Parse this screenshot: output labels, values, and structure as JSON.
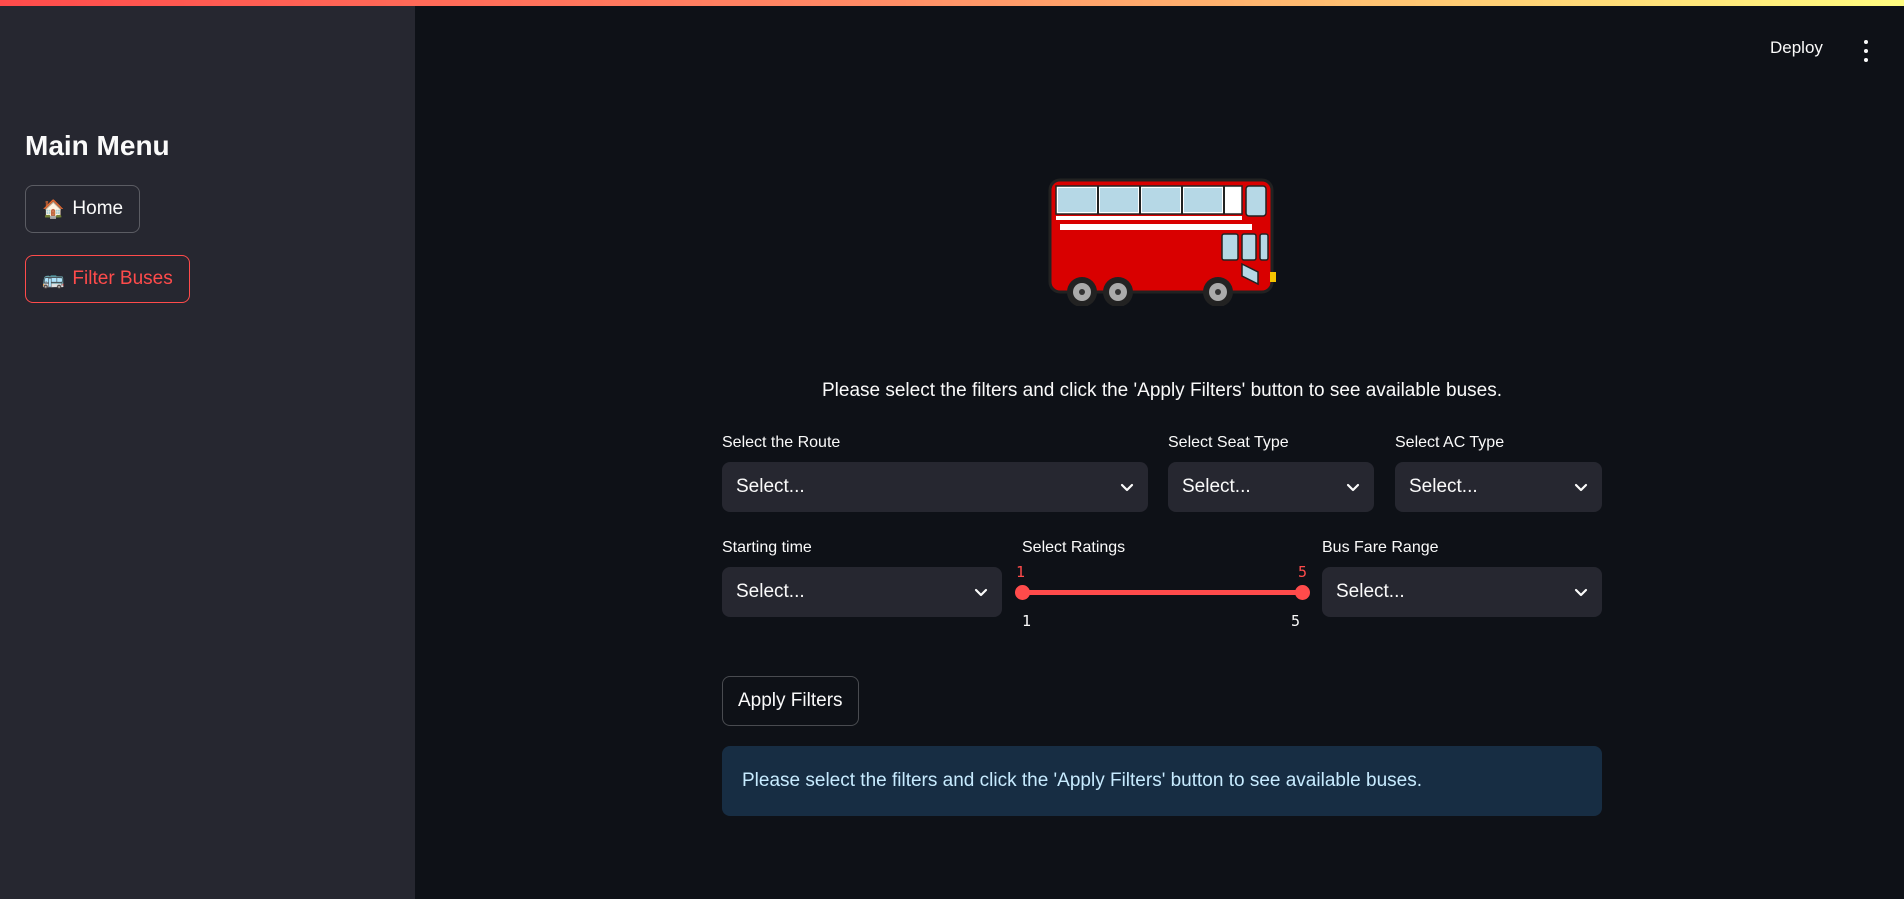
{
  "sidebar": {
    "title": "Main Menu",
    "items": [
      {
        "emoji": "🏠",
        "label": "Home"
      },
      {
        "emoji": "🚌",
        "label": "Filter Buses"
      }
    ]
  },
  "header": {
    "deploy_label": "Deploy"
  },
  "main": {
    "instruction": "Please select the filters and click the 'Apply Filters' button to see available buses.",
    "filters": {
      "route": {
        "label": "Select the Route",
        "value": "Select..."
      },
      "seat_type": {
        "label": "Select Seat Type",
        "value": "Select..."
      },
      "ac_type": {
        "label": "Select AC Type",
        "value": "Select..."
      },
      "starting_time": {
        "label": "Starting time",
        "value": "Select..."
      },
      "ratings": {
        "label": "Select Ratings",
        "low": "1",
        "high": "5",
        "min": "1",
        "max": "5"
      },
      "fare_range": {
        "label": "Bus Fare Range",
        "value": "Select..."
      }
    },
    "apply_button": "Apply Filters",
    "alert": "Please select the filters and click the 'Apply Filters' button to see available buses."
  },
  "colors": {
    "accent": "#ff4b4b",
    "background": "#0e1117",
    "sidebar": "#262730",
    "info_bg": "#172d43",
    "info_text": "#c7ebff"
  }
}
